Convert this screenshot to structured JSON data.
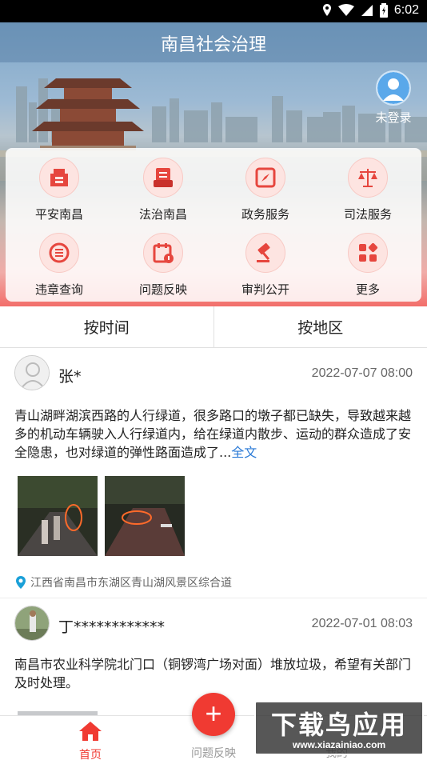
{
  "status_bar": {
    "time": "6:02"
  },
  "header": {
    "title": "南昌社会治理"
  },
  "user": {
    "login_label": "未登录"
  },
  "services": [
    {
      "label": "平安南昌",
      "icon": "safety-shield-icon"
    },
    {
      "label": "法治南昌",
      "icon": "law-book-icon"
    },
    {
      "label": "政务服务",
      "icon": "compass-icon"
    },
    {
      "label": "司法服务",
      "icon": "scales-icon"
    },
    {
      "label": "违章查询",
      "icon": "violation-icon"
    },
    {
      "label": "问题反映",
      "icon": "report-calendar-icon"
    },
    {
      "label": "审判公开",
      "icon": "gavel-icon"
    },
    {
      "label": "更多",
      "icon": "more-grid-icon"
    }
  ],
  "sort_tabs": [
    "按时间",
    "按地区"
  ],
  "posts": [
    {
      "author": "张*",
      "time": "2022-07-07 08:00",
      "text": "青山湖畔湖滨西路的人行绿道，很多路口的墩子都已缺失，导致越来越多的机动车辆驶入人行绿道内，给在绿道内散步、运动的群众造成了安全隐患，也对绿道的弹性路面造成了...",
      "full_text_link": "全文",
      "location": "江西省南昌市东湖区青山湖风景区综合道"
    },
    {
      "author": "丁************",
      "time": "2022-07-01 08:03",
      "text": "南昌市农业科学院北门口（铜锣湾广场对面）堆放垃圾，希望有关部门及时处理。"
    }
  ],
  "bottom_nav": {
    "home": "首页",
    "report": "问题反映",
    "mine": "我的"
  },
  "fab_label": "+",
  "watermark": {
    "title": "下载鸟应用",
    "url": "www.xiazainiao.com"
  },
  "colors": {
    "accent": "#f03a32",
    "link": "#2a7ad6",
    "icon_bg": "#fde4e1"
  }
}
